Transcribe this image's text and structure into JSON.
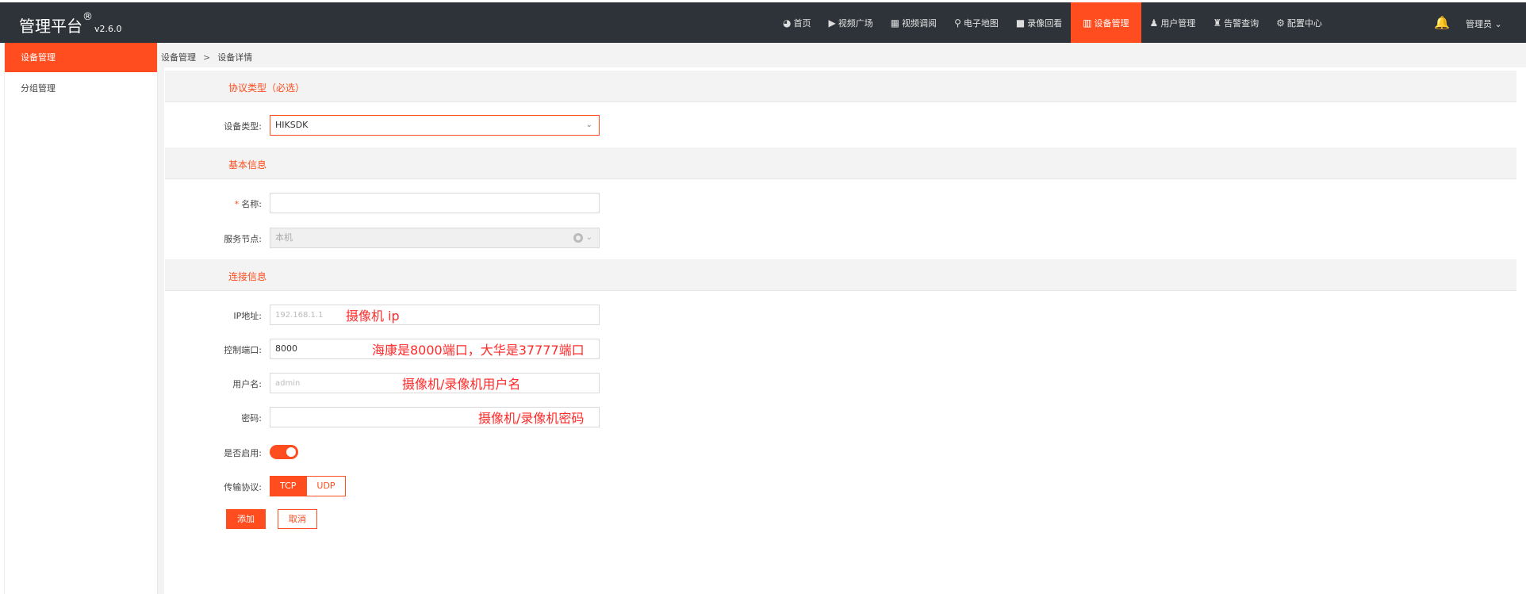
{
  "header": {
    "app_title": "管理平台",
    "reg_mark": "®",
    "version": "v2.6.0",
    "nav": [
      {
        "label": "首页",
        "icon": "dashboard-icon",
        "glyph": "◕"
      },
      {
        "label": "视频广场",
        "icon": "play-icon",
        "glyph": "▶"
      },
      {
        "label": "视频调阅",
        "icon": "layout-icon",
        "glyph": "▦"
      },
      {
        "label": "电子地图",
        "icon": "map-pin-icon",
        "glyph": "⚲"
      },
      {
        "label": "录像回看",
        "icon": "video-camera-icon",
        "glyph": "■"
      },
      {
        "label": "设备管理",
        "icon": "device-icon",
        "glyph": "▥",
        "active": true
      },
      {
        "label": "用户管理",
        "icon": "user-icon",
        "glyph": "♟"
      },
      {
        "label": "告警查询",
        "icon": "alarm-icon",
        "glyph": "♜"
      },
      {
        "label": "配置中心",
        "icon": "gear-icon",
        "glyph": "⚙"
      }
    ],
    "bell_glyph": "🔔",
    "user_label": "管理员",
    "user_caret": "⌄"
  },
  "sidebar": {
    "items": [
      {
        "label": "设备管理",
        "active": true
      },
      {
        "label": "分组管理",
        "active": false
      }
    ]
  },
  "breadcrumb": {
    "root": "设备管理",
    "sep": ">",
    "current": "设备详情"
  },
  "sections": {
    "protocol": "协议类型（必选）",
    "basic": "基本信息",
    "connection": "连接信息"
  },
  "form": {
    "device_type_label": "设备类型:",
    "device_type_value": "HIKSDK",
    "name_required": "*",
    "name_label": "名称:",
    "name_value": "",
    "node_label": "服务节点:",
    "node_value": "本机",
    "ip_label": "IP地址:",
    "ip_placeholder": "192.168.1.1",
    "port_label": "控制端口:",
    "port_value": "8000",
    "username_label": "用户名:",
    "username_placeholder": "admin",
    "password_label": "密码:",
    "password_value": "",
    "enabled_label": "是否启用:",
    "enabled": true,
    "transport_label": "传输协议:",
    "transport_options": [
      "TCP",
      "UDP"
    ],
    "transport_selected": "TCP",
    "submit_label": "添加",
    "cancel_label": "取消",
    "dropdown_arrow": "⌄"
  },
  "annotations": {
    "ip_note": "摄像机 ip",
    "port_note": "海康是8000端口，大华是37777端口",
    "username_note": "摄像机/录像机用户名",
    "password_note": "摄像机/录像机密码"
  },
  "colors": {
    "accent": "#ff4d1f",
    "topbar": "#2d3338",
    "annotation": "#ff2a2a"
  }
}
